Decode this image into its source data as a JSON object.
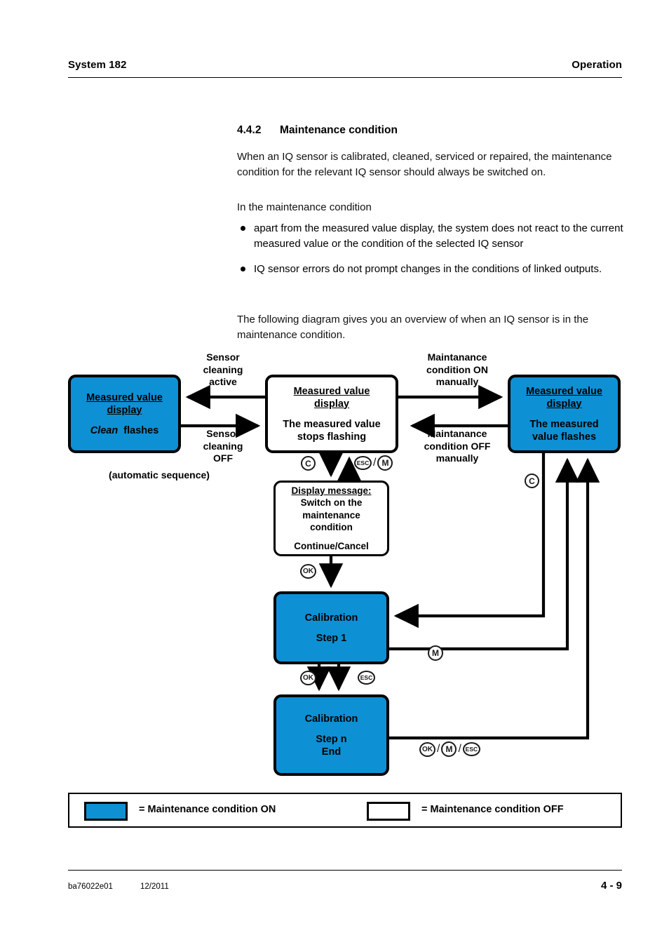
{
  "header": {
    "left": "System 182",
    "right": "Operation"
  },
  "section": {
    "number": "4.4.2",
    "title": "Maintenance condition"
  },
  "body": {
    "p1": "When an IQ sensor is calibrated, cleaned, serviced or repaired, the maintenance condition for the relevant IQ sensor should always be switched on.",
    "p2": "In the maintenance condition",
    "bullets": [
      "apart from the measured value display, the system does not react to the current measured value or the condition of the selected IQ sensor",
      "IQ sensor errors do not prompt changes in the conditions of linked outputs."
    ],
    "p3": "The following diagram gives you an overview of when an IQ sensor is in the maintenance condition."
  },
  "diagram": {
    "colors": {
      "maintenance_on": "#0e90d4",
      "maintenance_off": "#ffffff",
      "outline": "#000000"
    },
    "nodes": {
      "clean": {
        "title": "Measured value display",
        "title_l1": "Measured value",
        "title_l2": "display",
        "body_italic": "Clean",
        "body_rest": "flashes",
        "state": "maintenance-on"
      },
      "stopped": {
        "title_l1": "Measured value",
        "title_l2": "display",
        "body_l1": "The measured value",
        "body_l2": "stops flashing",
        "state": "maintenance-off"
      },
      "flashing": {
        "title_l1": "Measured value",
        "title_l2": "display",
        "body_l1": "The measured",
        "body_l2": "value flashes",
        "state": "maintenance-on"
      },
      "message": {
        "title": "Display message:",
        "line1": "Switch on the",
        "line2": "maintenance",
        "line3": "condition",
        "line4": "Continue/Cancel",
        "state": "maintenance-off"
      },
      "cal_step1": {
        "line1": "Calibration",
        "line2": "Step 1",
        "state": "maintenance-on"
      },
      "cal_stepn": {
        "line1": "Calibration",
        "line2": "Step n",
        "line3": "End",
        "state": "maintenance-on"
      }
    },
    "edge_labels": {
      "clean_active_l1": "Sensor",
      "clean_active_l2": "cleaning",
      "clean_active_l3": "active",
      "clean_off_l1": "Sensor",
      "clean_off_l2": "cleaning",
      "clean_off_l3": "OFF",
      "auto_sequence": "(automatic sequence)",
      "maint_on_l1": "Maintanance",
      "maint_on_l2": "condition ON",
      "maint_on_l3": "manually",
      "maint_off_l1": "Maintanance",
      "maint_off_l2": "condition OFF",
      "maint_off_l3": "manually"
    },
    "keys": {
      "c": "C",
      "m": "M",
      "ok": "OK",
      "esc": "ESC",
      "sep": "/"
    }
  },
  "legend": {
    "on_label": "= Maintenance condition ON",
    "off_label": "= Maintenance condition OFF"
  },
  "footer": {
    "doc": "ba76022e01",
    "date": "12/2011",
    "page": "4 - 9"
  }
}
